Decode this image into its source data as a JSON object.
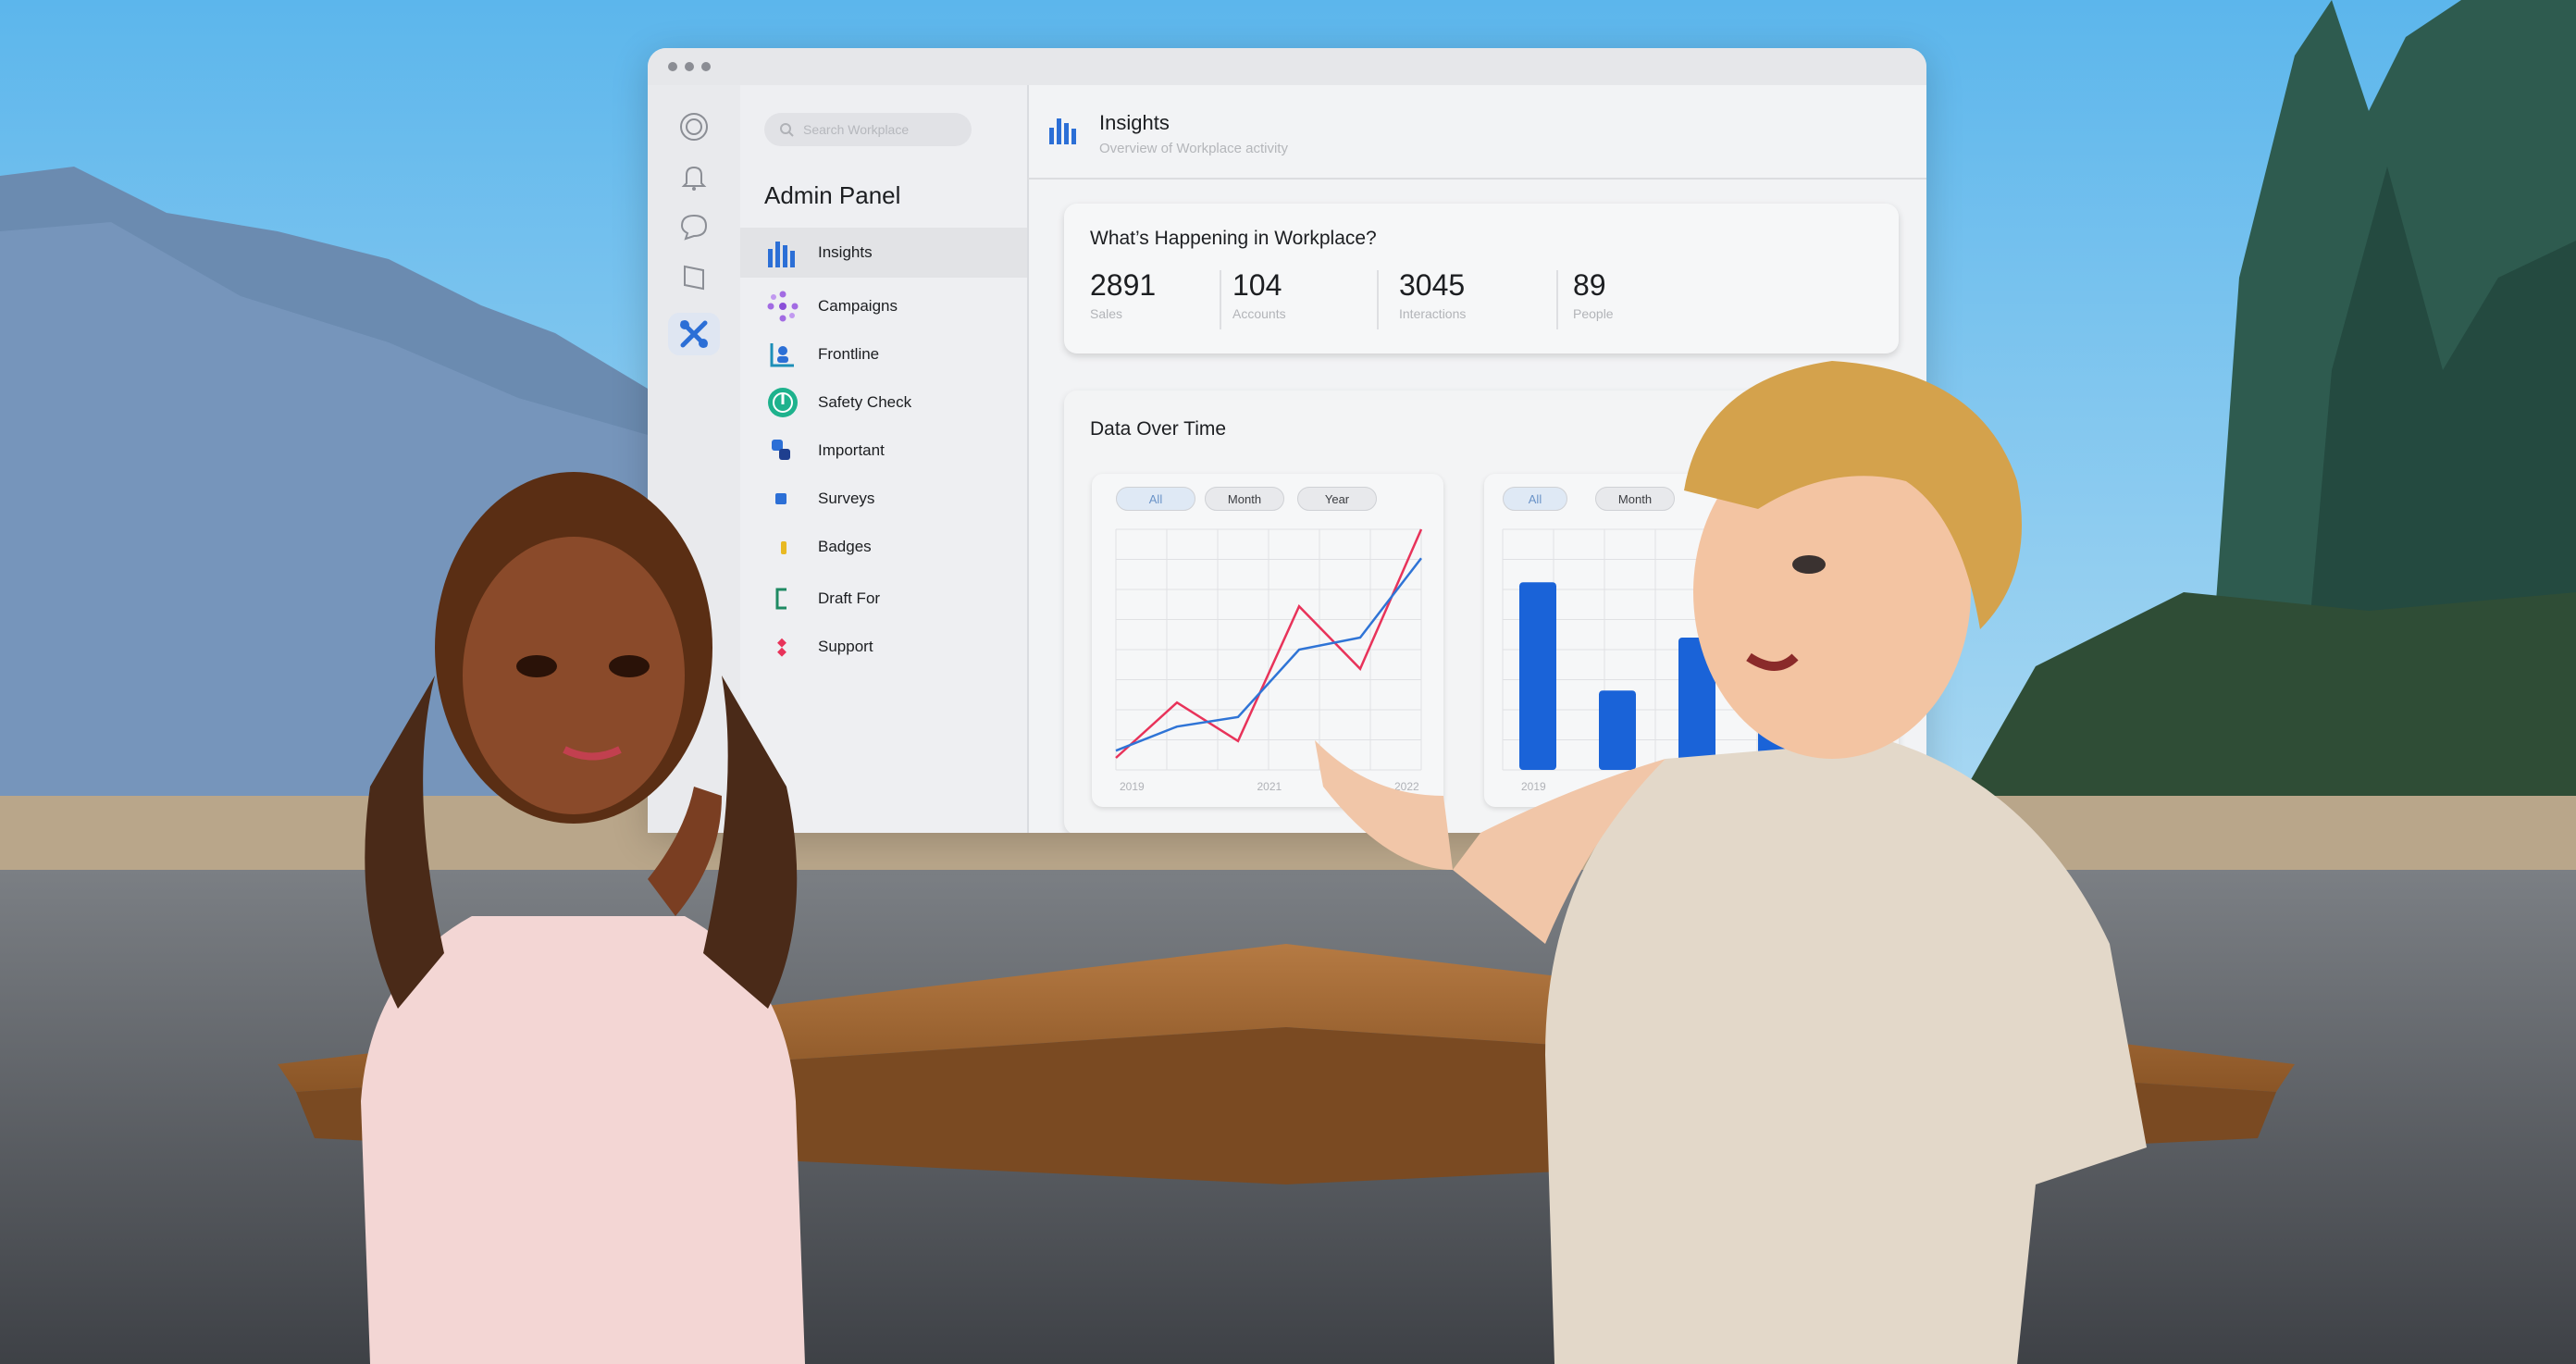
{
  "sidebar": {
    "search_placeholder": "Search Workplace",
    "title": "Admin Panel",
    "items": [
      {
        "label": "Insights",
        "icon": "bar-chart-icon"
      },
      {
        "label": "Campaigns",
        "icon": "campaigns-icon"
      },
      {
        "label": "Frontline",
        "icon": "frontline-icon"
      },
      {
        "label": "Safety Check",
        "icon": "safety-check-icon"
      },
      {
        "label": "Important",
        "icon": "important-icon"
      },
      {
        "label": "Surveys",
        "icon": "surveys-icon"
      },
      {
        "label": "Badges",
        "icon": "badges-icon"
      },
      {
        "label": "Draft For",
        "icon": "draft-icon"
      },
      {
        "label": "Support",
        "icon": "support-icon"
      }
    ]
  },
  "rail": {
    "icons": [
      "home-icon",
      "bell-icon",
      "chat-icon",
      "book-icon",
      "admin-tools-icon"
    ]
  },
  "header": {
    "title": "Insights",
    "subtitle": "Overview of Workplace activity"
  },
  "summary": {
    "title": "What’s Happening in Workplace?",
    "stats": [
      {
        "value": "2891",
        "label": "Sales"
      },
      {
        "value": "104",
        "label": "Accounts"
      },
      {
        "value": "3045",
        "label": "Interactions"
      },
      {
        "value": "89",
        "label": "People"
      }
    ]
  },
  "data_over_time": {
    "title": "Data Over Time",
    "filters": [
      "All",
      "Month",
      "Year"
    ],
    "active_filter": "All"
  },
  "chart_data": [
    {
      "type": "line",
      "x": [
        "2019",
        "",
        "2021",
        "",
        "2022",
        ""
      ],
      "tick_labels": [
        "2019",
        "2021",
        "2022"
      ],
      "series": [
        {
          "color": "#e8335a",
          "values": [
            5,
            28,
            12,
            68,
            42,
            100
          ]
        },
        {
          "color": "#2f74d6",
          "values": [
            8,
            18,
            22,
            50,
            55,
            88
          ]
        }
      ],
      "ylim": [
        0,
        100
      ],
      "grid": true
    },
    {
      "type": "bar",
      "categories": [
        "2019",
        "2021",
        "2022",
        ""
      ],
      "values": [
        78,
        33,
        55,
        20
      ],
      "ylim": [
        0,
        100
      ],
      "color": "#1a63d8",
      "filters": [
        "All",
        "Month"
      ],
      "active_filter": "All",
      "grid": true
    }
  ],
  "colors": {
    "accent": "#1877f2",
    "sky": "#7fc3ea",
    "panel_bg": "#f2f3f5"
  }
}
